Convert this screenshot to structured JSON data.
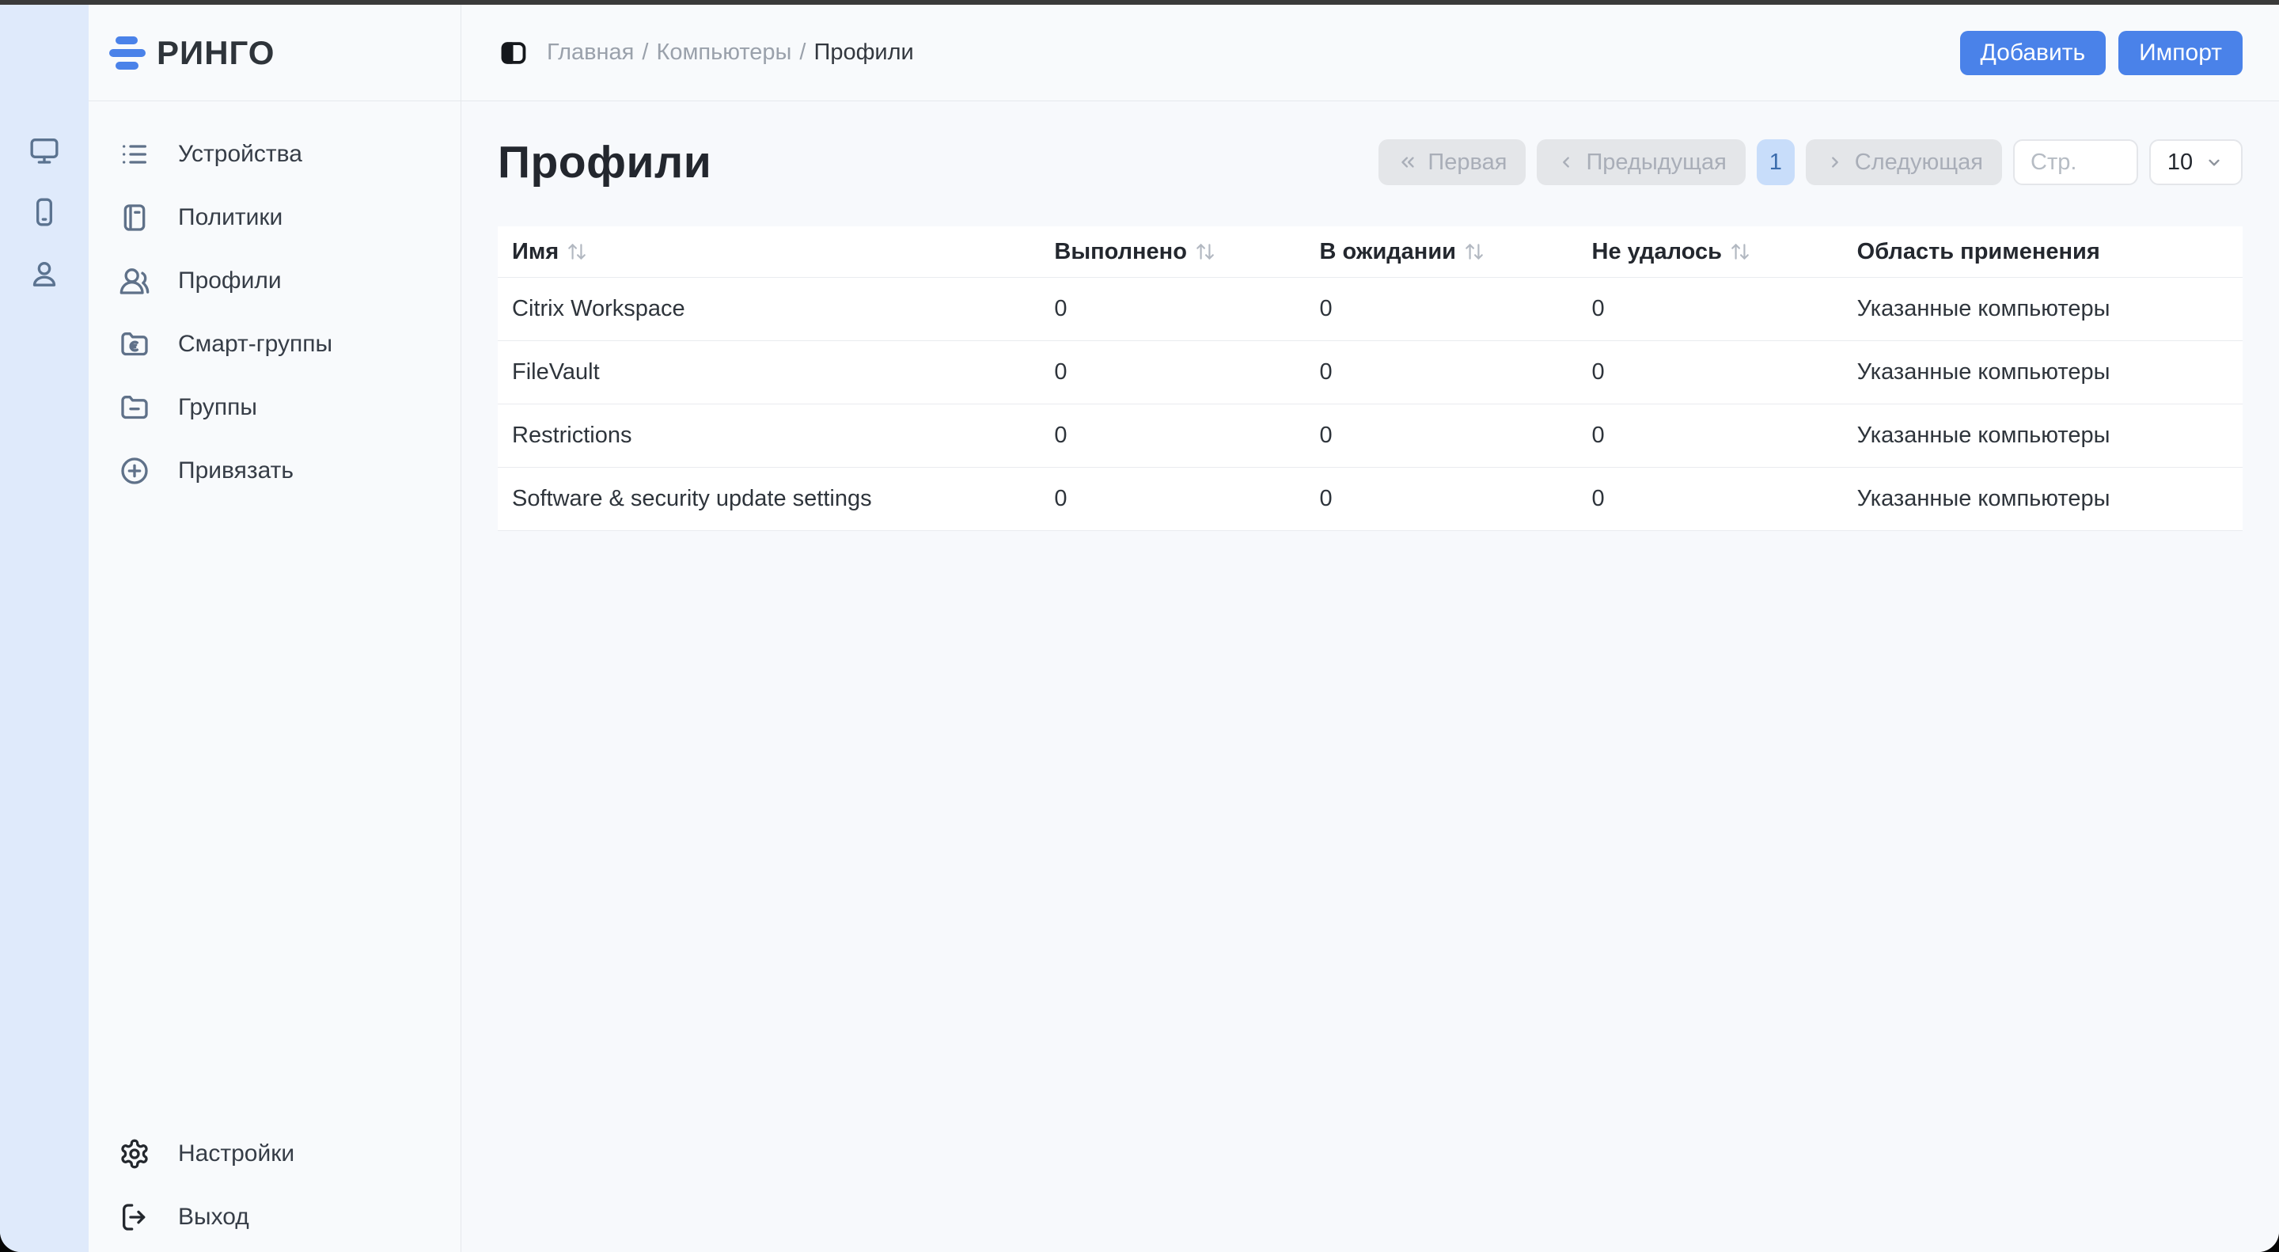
{
  "brand": {
    "name": "РИНГО",
    "logo_icon": "three-bars-logo-icon",
    "accent_color": "#4a82e9"
  },
  "rail": {
    "items": [
      {
        "icon": "monitor-icon"
      },
      {
        "icon": "smartphone-icon"
      },
      {
        "icon": "user-icon"
      }
    ]
  },
  "sidebar": {
    "items": [
      {
        "icon": "list-icon",
        "label": "Устройства"
      },
      {
        "icon": "notebook-icon",
        "label": "Политики"
      },
      {
        "icon": "users-icon",
        "label": "Профили"
      },
      {
        "icon": "smart-folder-icon",
        "label": "Смарт-группы"
      },
      {
        "icon": "folder-minus-icon",
        "label": "Группы"
      },
      {
        "icon": "circle-plus-icon",
        "label": "Привязать"
      }
    ],
    "footer_items": [
      {
        "icon": "gear-icon",
        "label": "Настройки"
      },
      {
        "icon": "logout-icon",
        "label": "Выход"
      }
    ]
  },
  "header": {
    "breadcrumb": {
      "home": "Главная",
      "section": "Компьютеры",
      "current": "Профили",
      "separator": "/"
    },
    "actions": [
      {
        "label": "Добавить"
      },
      {
        "label": "Импорт"
      }
    ]
  },
  "main": {
    "title": "Профили",
    "pagination": {
      "first": "Первая",
      "prev": "Предыдущая",
      "page": "1",
      "next": "Следующая",
      "page_input_placeholder": "Стр.",
      "page_size": "10"
    },
    "table": {
      "columns": [
        {
          "label": "Имя",
          "sortable": true
        },
        {
          "label": "Выполнено",
          "sortable": true
        },
        {
          "label": "В ожидании",
          "sortable": true
        },
        {
          "label": "Не удалось",
          "sortable": true
        },
        {
          "label": "Область применения",
          "sortable": false
        }
      ],
      "rows": [
        [
          "Citrix Workspace",
          "0",
          "0",
          "0",
          "Указанные компьютеры"
        ],
        [
          "FileVault",
          "0",
          "0",
          "0",
          "Указанные компьютеры"
        ],
        [
          "Restrictions",
          "0",
          "0",
          "0",
          "Указанные компьютеры"
        ],
        [
          "Software & security update settings",
          "0",
          "0",
          "0",
          "Указанные компьютеры"
        ]
      ]
    }
  },
  "colors": {
    "accent": "#4a82e9",
    "rail_bg": "#dfeafb",
    "sidebar_bg": "#f8fafc",
    "page_bg": "#f7f9fc",
    "active_page_bg": "#c8ddfa",
    "active_page_text": "#3b6cac",
    "disabled_btn_bg": "#e4e6e9",
    "disabled_btn_text": "#a9aeb8",
    "top_strip": "#3a3a3a"
  }
}
